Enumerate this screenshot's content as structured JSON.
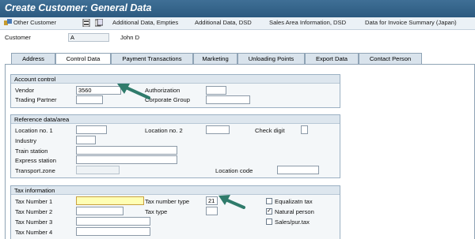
{
  "window": {
    "title": "Create Customer: General Data"
  },
  "toolbar": {
    "other_customer": "Other Customer",
    "additional_data_empties": "Additional Data, Empties",
    "additional_data_dsd": "Additional Data, DSD",
    "sales_area_info_dsd": "Sales Area Information, DSD",
    "invoice_summary": "Data for Invoice Summary (Japan)"
  },
  "customer": {
    "label": "Customer",
    "value": "A",
    "name": "John D"
  },
  "tabs": [
    {
      "label": "Address"
    },
    {
      "label": "Control Data"
    },
    {
      "label": "Payment Transactions"
    },
    {
      "label": "Marketing"
    },
    {
      "label": "Unloading Points"
    },
    {
      "label": "Export Data"
    },
    {
      "label": "Contact Person"
    }
  ],
  "account_control": {
    "heading": "Account control",
    "vendor_label": "Vendor",
    "vendor_value": "3560",
    "authorization_label": "Authorization",
    "trading_partner_label": "Trading Partner",
    "corporate_group_label": "Corporate Group"
  },
  "reference": {
    "heading": "Reference data/area",
    "location1_label": "Location no. 1",
    "location2_label": "Location no. 2",
    "check_digit_label": "Check digit",
    "industry_label": "Industry",
    "train_station_label": "Train station",
    "express_station_label": "Express station",
    "transport_zone_label": "Transport.zone",
    "location_code_label": "Location code"
  },
  "tax": {
    "heading": "Tax information",
    "tax1_label": "Tax Number 1",
    "tax2_label": "Tax Number 2",
    "tax3_label": "Tax Number 3",
    "tax4_label": "Tax Number 4",
    "tax_number_type_label": "Tax number type",
    "tax_number_type_value": "21",
    "tax_type_label": "Tax type",
    "equalization_tax_label": "Equalizatn tax",
    "natural_person_label": "Natural person",
    "sales_pur_tax_label": "Sales/pur.tax",
    "equalization_tax_checked": false,
    "natural_person_checked": true,
    "sales_pur_tax_checked": false
  },
  "colors": {
    "arrow": "#2f7b6b",
    "title_bar": "#2c5a80"
  }
}
